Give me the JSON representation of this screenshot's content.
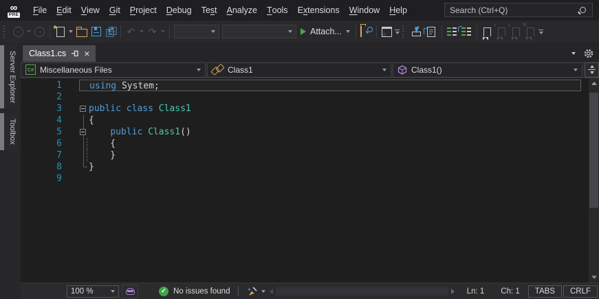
{
  "titlebar": {
    "logo_glyph": "∞",
    "logo_badge": "PRE",
    "menus": [
      {
        "label": "File",
        "u": 0
      },
      {
        "label": "Edit",
        "u": 0
      },
      {
        "label": "View",
        "u": 0
      },
      {
        "label": "Git",
        "u": 0
      },
      {
        "label": "Project",
        "u": 0
      },
      {
        "label": "Debug",
        "u": 0
      },
      {
        "label": "Test",
        "u": 2
      },
      {
        "label": "Analyze",
        "u": 0
      },
      {
        "label": "Tools",
        "u": 0
      },
      {
        "label": "Extensions",
        "u": 1
      },
      {
        "label": "Window",
        "u": 0
      },
      {
        "label": "Help",
        "u": 0
      }
    ],
    "search_placeholder": "Search (Ctrl+Q)"
  },
  "toolbar": {
    "attach_label": "Attach...",
    "undo_glyph": "↶",
    "redo_glyph": "↷"
  },
  "tab": {
    "title": "Class1.cs",
    "close_glyph": "×"
  },
  "navbar": {
    "project_icon_text": "C#",
    "project": "Miscellaneous Files",
    "type": "Class1",
    "member": "Class1()"
  },
  "sidebar": {
    "tabs": [
      "Server Explorer",
      "Toolbox"
    ]
  },
  "editor": {
    "lines": [
      {
        "n": "1",
        "cur": true,
        "tokens": [
          {
            "t": "using",
            "c": "kw"
          },
          {
            "t": " System;",
            "c": "pl"
          }
        ]
      },
      {
        "n": "2",
        "tokens": []
      },
      {
        "n": "3",
        "b": true,
        "tokens": [
          {
            "t": "public",
            "c": "kw"
          },
          {
            "t": " ",
            "c": "pl"
          },
          {
            "t": "class",
            "c": "kw"
          },
          {
            "t": " ",
            "c": "pl"
          },
          {
            "t": "Class1",
            "c": "ty"
          }
        ]
      },
      {
        "n": "4",
        "g": "v",
        "tokens": [
          {
            "t": "{",
            "c": "pl"
          }
        ]
      },
      {
        "n": "5",
        "b": true,
        "g": "v",
        "tokens": [
          {
            "t": "    ",
            "c": "pl"
          },
          {
            "t": "public",
            "c": "kw"
          },
          {
            "t": " ",
            "c": "pl"
          },
          {
            "t": "Class1",
            "c": "ty"
          },
          {
            "t": "()",
            "c": "pl"
          }
        ]
      },
      {
        "n": "6",
        "g": "vd",
        "tokens": [
          {
            "t": "    {",
            "c": "pl"
          }
        ]
      },
      {
        "n": "7",
        "g": "vd",
        "tokens": [
          {
            "t": "    }",
            "c": "pl"
          }
        ]
      },
      {
        "n": "8",
        "g": "c",
        "tokens": [
          {
            "t": "}",
            "c": "pl"
          }
        ]
      },
      {
        "n": "9",
        "tokens": []
      }
    ]
  },
  "statusbar": {
    "zoom": "100 %",
    "check_glyph": "✓",
    "health": "No issues found",
    "line": "Ln: 1",
    "column": "Ch: 1",
    "indent_mode": "TABS",
    "line_ending": "CRLF"
  },
  "colors": {
    "editor_bg": "#1e1e1e",
    "chrome_bg": "#29292c",
    "keyword": "#569cd6",
    "type_name": "#4ec9b0",
    "plain_text": "#d4d4d4",
    "line_number": "#2b91af",
    "accent_gold": "#d9a85c",
    "accent_blue": "#4f9cd6",
    "accent_green": "#3fa14c",
    "accent_purple": "#b180d7"
  }
}
